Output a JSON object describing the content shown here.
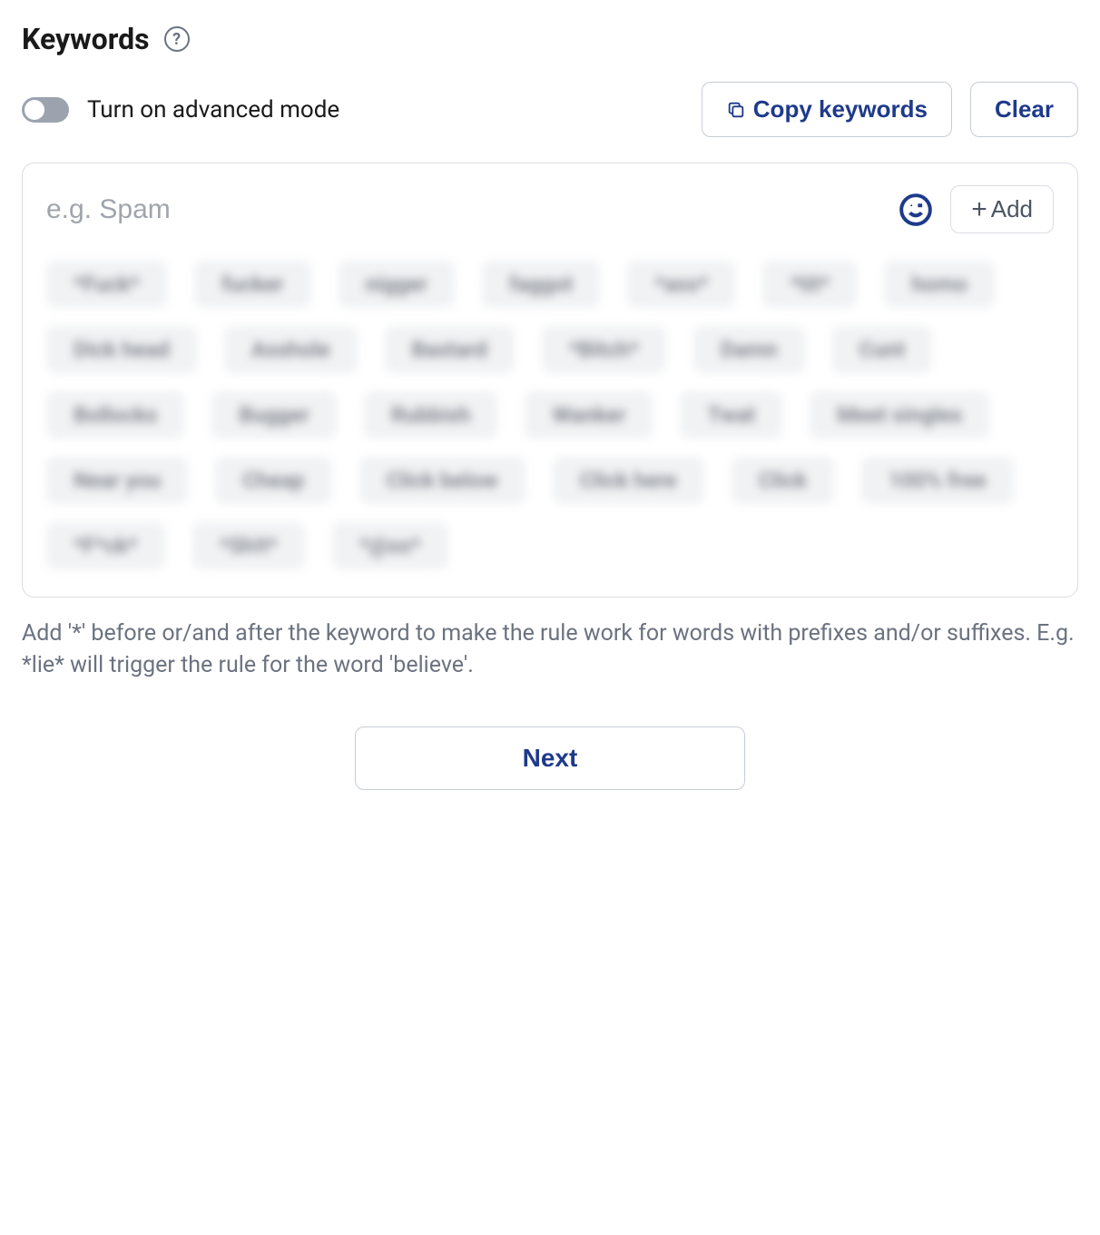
{
  "header": {
    "title": "Keywords"
  },
  "controls": {
    "advanced_toggle_label": "Turn on advanced mode",
    "advanced_toggle_on": false,
    "copy_button_label": "Copy keywords",
    "clear_button_label": "Clear"
  },
  "input": {
    "placeholder": "e.g. Spam",
    "add_button_label": "Add",
    "emoji_icon": "wink-smiley-icon"
  },
  "keywords_blurred": true,
  "keywords": [
    "*Fuck*",
    "fucker",
    "nigger",
    "faggot",
    "*ass*",
    "*tit*",
    "homo",
    "Dick head",
    "Asshole",
    "Bastard",
    "*Bitch*",
    "Damn",
    "Cunt",
    "Bollocks",
    "Bugger",
    "Rubbish",
    "Wanker",
    "Twat",
    "Meet singles",
    "Near you",
    "Cheap",
    "Click below",
    "Click here",
    "Click",
    "100% free",
    "*F*ck*",
    "*Sh!t*",
    "*@ss*"
  ],
  "hint_text": "Add '*' before or/and after the keyword to make the rule work for words with prefixes and/or suffixes. E.g. *lie* will trigger the rule for the word 'believe'.",
  "next_button_label": "Next",
  "colors": {
    "accent": "#1e3a8a",
    "chip_bg": "#f1f2f4",
    "border": "#dadde3",
    "text_muted": "#6b7280"
  }
}
